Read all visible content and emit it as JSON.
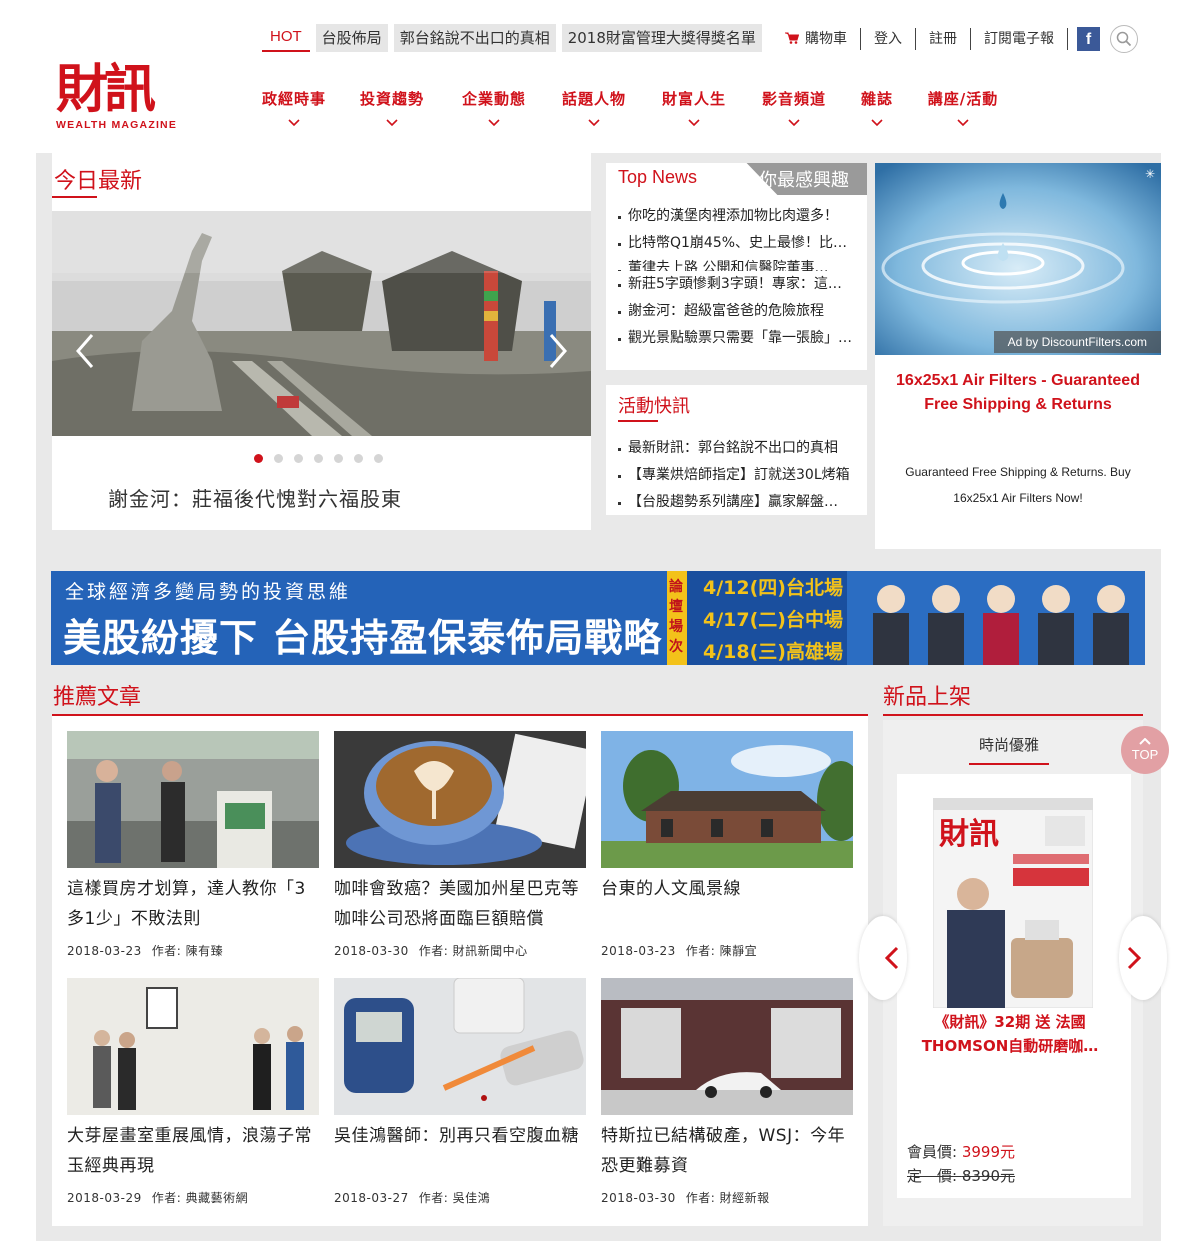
{
  "logo": {
    "main": "財訊",
    "sub": "WEALTH MAGAZINE"
  },
  "hot": {
    "label": "HOT",
    "tags": [
      "台股佈局",
      "郭台銘說不出口的真相",
      "2018財富管理大獎得獎名單"
    ]
  },
  "top_links": {
    "cart": "購物車",
    "login": "登入",
    "register": "註冊",
    "subscribe": "訂閱電子報",
    "facebook": "f"
  },
  "nav": [
    "政經時事",
    "投資趨勢",
    "企業動態",
    "話題人物",
    "財富人生",
    "影音頻道",
    "雜誌",
    "講座/活動"
  ],
  "today": {
    "title": "今日最新",
    "caption": "謝金河：莊福後代愧對六福股東",
    "dots": 7,
    "active_dot": 0
  },
  "top_news": {
    "tab_active": "Top News",
    "tab_inactive": "你最感興趣",
    "items": [
      "你吃的漢堡肉裡添加物比肉還多！",
      "比特幣Q1崩45%、史上最慘！比特…",
      "董律去上路 公開和信醫院董事…",
      "新莊5字頭慘剩3字頭！專家：這…",
      "謝金河：超級富爸爸的危險旅程",
      "觀光景點驗票只需要「靠一張臉」…"
    ]
  },
  "events": {
    "title": "活動快訊",
    "items": [
      "最新財訊：郭台銘說不出口的真相",
      "【專業烘焙師指定】訂就送30L烤箱",
      "【台股趨勢系列講座】贏家解盤…"
    ]
  },
  "ad": {
    "by": "Ad by DiscountFilters.com",
    "title": "16x25x1 Air Filters - Guaranteed Free Shipping & Returns",
    "desc": "Guaranteed Free Shipping & Returns. Buy 16x25x1 Air Filters Now!"
  },
  "banner": {
    "line1": "全球經濟多變局勢的投資思維",
    "line2": "美股紛擾下 台股持盈保泰佈局戰略",
    "side": "論壇場次",
    "dates": [
      "4/12(四)台北場",
      "4/17(二)台中場",
      "4/18(三)高雄場"
    ]
  },
  "recommend": {
    "title": "推薦文章",
    "articles": [
      {
        "title": "這樣買房才划算，達人教你「3多1少」不敗法則",
        "date": "2018-03-23",
        "author": "作者: 陳有臻"
      },
      {
        "title": "咖啡會致癌？美國加州星巴克等咖啡公司恐將面臨巨額賠償",
        "date": "2018-03-30",
        "author": "作者: 財訊新聞中心"
      },
      {
        "title": "台東的人文風景線",
        "date": "2018-03-23",
        "author": "作者: 陳靜宜"
      },
      {
        "title": "大芽屋畫室重展風情，浪蕩子常玉經典再現",
        "date": "2018-03-29",
        "author": "作者: 典藏藝術網"
      },
      {
        "title": "吳佳鴻醫師：別再只看空腹血糖",
        "date": "2018-03-27",
        "author": "作者: 吳佳鴻"
      },
      {
        "title": "特斯拉已結構破產，WSJ：今年恐更難募資",
        "date": "2018-03-30",
        "author": "作者: 財經新報"
      }
    ]
  },
  "new_products": {
    "title": "新品上架",
    "tab": "時尚優雅",
    "product_name": "《財訊》32期 送 法國THOMSON自動研磨咖…",
    "member_price_label": "會員價: ",
    "member_price": "3999元",
    "list_price_label": "定　價: ",
    "list_price": "8390元"
  },
  "top_button": "TOP",
  "colors": {
    "brand_red": "#d0121b",
    "content_bg": "#e9e9e9"
  }
}
